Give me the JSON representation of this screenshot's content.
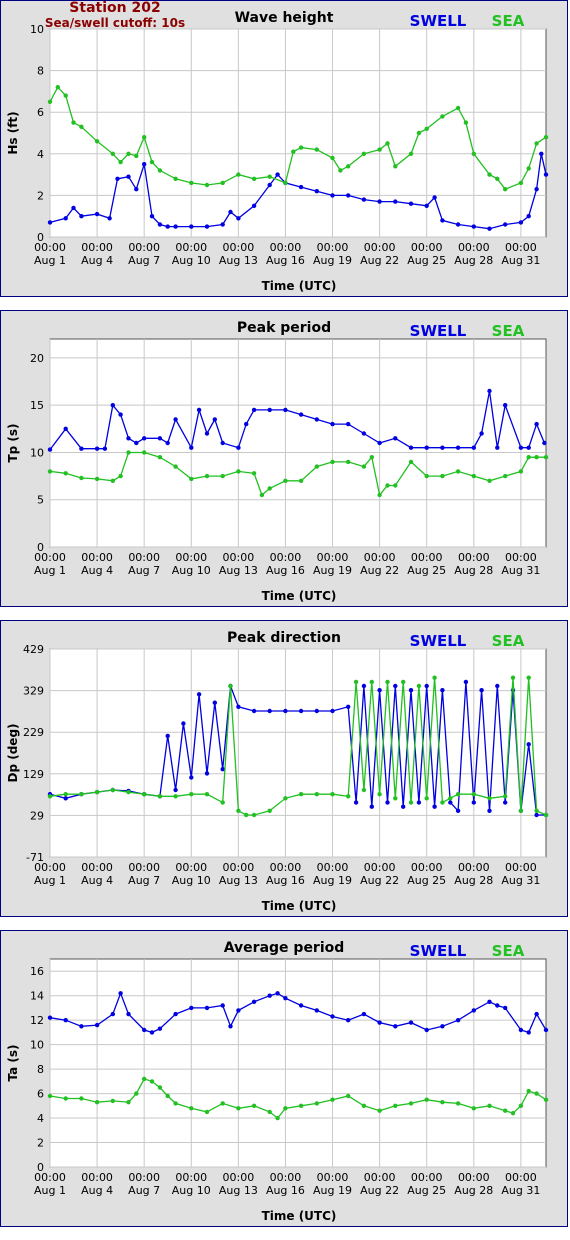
{
  "header": {
    "station": "Station 202",
    "cutoff": "Sea/swell cutoff: 10s"
  },
  "colors": {
    "swell": "#0000e0",
    "sea": "#22c022",
    "station": "#8b0000"
  },
  "x_axis": {
    "ticks": [
      {
        "time": "00:00",
        "date": "Aug 1"
      },
      {
        "time": "00:00",
        "date": "Aug 4"
      },
      {
        "time": "00:00",
        "date": "Aug 7"
      },
      {
        "time": "00:00",
        "date": "Aug 10"
      },
      {
        "time": "00:00",
        "date": "Aug 13"
      },
      {
        "time": "00:00",
        "date": "Aug 16"
      },
      {
        "time": "00:00",
        "date": "Aug 19"
      },
      {
        "time": "00:00",
        "date": "Aug 22"
      },
      {
        "time": "00:00",
        "date": "Aug 25"
      },
      {
        "time": "00:00",
        "date": "Aug 28"
      },
      {
        "time": "00:00",
        "date": "Aug 31"
      }
    ],
    "label": "Time (UTC)"
  },
  "chart_data": [
    {
      "type": "line",
      "title": "Wave height",
      "ylabel": "Hs (ft)",
      "xlabel": "Time (UTC)",
      "ylim": [
        0,
        10
      ],
      "yticks": [
        0,
        2,
        4,
        6,
        8,
        10
      ],
      "xlim": [
        0,
        31.6
      ],
      "legend_position": "top-right",
      "grid": true,
      "series": [
        {
          "name": "SWELL",
          "color": "#0000e0",
          "x": [
            0,
            1,
            1.5,
            2,
            3,
            3.8,
            4.3,
            5,
            5.5,
            6,
            6.5,
            7,
            7.5,
            8,
            9,
            10,
            11,
            11.5,
            12,
            13,
            14,
            14.5,
            15,
            16,
            17,
            18,
            19,
            20,
            21,
            22,
            23,
            24,
            24.5,
            25,
            26,
            27,
            28,
            29,
            30,
            30.5,
            31,
            31.3,
            31.6
          ],
          "y": [
            0.7,
            0.9,
            1.4,
            1.0,
            1.1,
            0.9,
            2.8,
            2.9,
            2.3,
            3.5,
            1.0,
            0.6,
            0.5,
            0.5,
            0.5,
            0.5,
            0.6,
            1.2,
            0.9,
            1.5,
            2.5,
            3.0,
            2.6,
            2.4,
            2.2,
            2.0,
            2.0,
            1.8,
            1.7,
            1.7,
            1.6,
            1.5,
            1.9,
            0.8,
            0.6,
            0.5,
            0.4,
            0.6,
            0.7,
            1.0,
            2.3,
            4.0,
            3.0
          ]
        },
        {
          "name": "SEA",
          "color": "#22c022",
          "x": [
            0,
            0.5,
            1,
            1.5,
            2,
            3,
            4,
            4.5,
            5,
            5.5,
            6,
            6.5,
            7,
            8,
            9,
            10,
            11,
            12,
            13,
            14,
            15,
            15.5,
            16,
            17,
            18,
            18.5,
            19,
            20,
            21,
            21.5,
            22,
            23,
            23.5,
            24,
            25,
            26,
            26.5,
            27,
            28,
            28.5,
            29,
            30,
            30.5,
            31,
            31.6
          ],
          "y": [
            6.5,
            7.2,
            6.8,
            5.5,
            5.3,
            4.6,
            4.0,
            3.6,
            4.0,
            3.9,
            4.8,
            3.6,
            3.2,
            2.8,
            2.6,
            2.5,
            2.6,
            3.0,
            2.8,
            2.9,
            2.6,
            4.1,
            4.3,
            4.2,
            3.8,
            3.2,
            3.4,
            4.0,
            4.2,
            4.5,
            3.4,
            4.0,
            5.0,
            5.2,
            5.8,
            6.2,
            5.5,
            4.0,
            3.0,
            2.8,
            2.3,
            2.6,
            3.3,
            4.5,
            4.8
          ]
        }
      ]
    },
    {
      "type": "line",
      "title": "Peak period",
      "ylabel": "Tp (s)",
      "xlabel": "Time (UTC)",
      "ylim": [
        0,
        22
      ],
      "yticks": [
        0,
        5,
        10,
        15,
        20
      ],
      "xlim": [
        0,
        31.6
      ],
      "legend_position": "top-right",
      "grid": true,
      "series": [
        {
          "name": "SWELL",
          "color": "#0000e0",
          "x": [
            0,
            1,
            2,
            3,
            3.5,
            4,
            4.5,
            5,
            5.5,
            6,
            7,
            7.5,
            8,
            9,
            9.5,
            10,
            10.5,
            11,
            12,
            12.5,
            13,
            14,
            15,
            16,
            17,
            18,
            19,
            20,
            21,
            22,
            23,
            24,
            25,
            26,
            27,
            27.5,
            28,
            28.5,
            29,
            30,
            30.5,
            31,
            31.5
          ],
          "y": [
            10.3,
            12.5,
            10.4,
            10.4,
            10.4,
            15.0,
            14.0,
            11.5,
            11.0,
            11.5,
            11.5,
            11.0,
            13.5,
            10.5,
            14.5,
            12.0,
            13.5,
            11.0,
            10.5,
            13.0,
            14.5,
            14.5,
            14.5,
            14.0,
            13.5,
            13.0,
            13.0,
            12.0,
            11.0,
            11.5,
            10.5,
            10.5,
            10.5,
            10.5,
            10.5,
            12.0,
            16.5,
            10.5,
            15.0,
            10.5,
            10.5,
            13.0,
            11.0
          ]
        },
        {
          "name": "SEA",
          "color": "#22c022",
          "x": [
            0,
            1,
            2,
            3,
            4,
            4.5,
            5,
            6,
            7,
            8,
            9,
            10,
            11,
            12,
            13,
            13.5,
            14,
            15,
            16,
            17,
            18,
            19,
            20,
            20.5,
            21,
            21.5,
            22,
            23,
            24,
            25,
            26,
            27,
            28,
            29,
            30,
            30.5,
            31,
            31.6
          ],
          "y": [
            8.0,
            7.8,
            7.3,
            7.2,
            7.0,
            7.5,
            10.0,
            10.0,
            9.5,
            8.5,
            7.2,
            7.5,
            7.5,
            8.0,
            7.8,
            5.5,
            6.2,
            7.0,
            7.0,
            8.5,
            9.0,
            9.0,
            8.5,
            9.5,
            5.5,
            6.5,
            6.5,
            9.0,
            7.5,
            7.5,
            8.0,
            7.5,
            7.0,
            7.5,
            8.0,
            9.5,
            9.5,
            9.5
          ]
        }
      ]
    },
    {
      "type": "line",
      "title": "Peak direction",
      "ylabel": "Dp (deg)",
      "xlabel": "Time (UTC)",
      "ylim": [
        -71,
        429
      ],
      "yticks": [
        -71,
        29,
        129,
        229,
        329,
        429
      ],
      "xlim": [
        0,
        31.6
      ],
      "legend_position": "top-right",
      "grid": true,
      "series": [
        {
          "name": "SWELL",
          "color": "#0000e0",
          "x": [
            0,
            1,
            2,
            3,
            4,
            5,
            6,
            7,
            7.5,
            8,
            8.5,
            9,
            9.5,
            10,
            10.5,
            11,
            11.5,
            12,
            13,
            14,
            15,
            16,
            17,
            18,
            19,
            19.5,
            20,
            20.5,
            21,
            21.5,
            22,
            22.5,
            23,
            23.5,
            24,
            24.5,
            25,
            25.5,
            26,
            26.5,
            27,
            27.5,
            28,
            28.5,
            29,
            29.5,
            30,
            30.5,
            31,
            31.6
          ],
          "y": [
            80,
            70,
            80,
            85,
            90,
            88,
            80,
            75,
            220,
            90,
            250,
            120,
            320,
            130,
            300,
            140,
            340,
            290,
            280,
            280,
            280,
            280,
            280,
            280,
            290,
            60,
            340,
            50,
            330,
            60,
            340,
            50,
            330,
            60,
            340,
            50,
            330,
            60,
            40,
            350,
            60,
            330,
            40,
            340,
            60,
            330,
            40,
            200,
            30,
            30
          ]
        },
        {
          "name": "SEA",
          "color": "#22c022",
          "x": [
            0,
            1,
            2,
            3,
            4,
            5,
            6,
            7,
            8,
            9,
            10,
            11,
            11.5,
            12,
            12.5,
            13,
            14,
            15,
            16,
            17,
            18,
            19,
            19.5,
            20,
            20.5,
            21,
            21.5,
            22,
            22.5,
            23,
            23.5,
            24,
            24.5,
            25,
            25.5,
            26,
            27,
            28,
            29,
            29.5,
            30,
            30.5,
            31,
            31.6
          ],
          "y": [
            75,
            80,
            80,
            85,
            90,
            85,
            80,
            75,
            75,
            80,
            80,
            60,
            340,
            40,
            30,
            30,
            40,
            70,
            80,
            80,
            80,
            75,
            350,
            90,
            350,
            80,
            350,
            70,
            350,
            60,
            340,
            70,
            360,
            60,
            70,
            80,
            80,
            70,
            75,
            360,
            40,
            360,
            40,
            30
          ]
        }
      ]
    },
    {
      "type": "line",
      "title": "Average period",
      "ylabel": "Ta (s)",
      "xlabel": "Time (UTC)",
      "ylim": [
        0,
        17
      ],
      "yticks": [
        0,
        2,
        4,
        6,
        8,
        10,
        12,
        14,
        16
      ],
      "xlim": [
        0,
        31.6
      ],
      "legend_position": "top-right",
      "grid": true,
      "series": [
        {
          "name": "SWELL",
          "color": "#0000e0",
          "x": [
            0,
            1,
            2,
            3,
            4,
            4.5,
            5,
            6,
            6.5,
            7,
            8,
            9,
            10,
            11,
            11.5,
            12,
            13,
            14,
            14.5,
            15,
            16,
            17,
            18,
            19,
            20,
            21,
            22,
            23,
            24,
            25,
            26,
            27,
            28,
            28.5,
            29,
            30,
            30.5,
            31,
            31.6
          ],
          "y": [
            12.2,
            12.0,
            11.5,
            11.6,
            12.5,
            14.2,
            12.5,
            11.2,
            11.0,
            11.3,
            12.5,
            13.0,
            13.0,
            13.2,
            11.5,
            12.8,
            13.5,
            14.0,
            14.2,
            13.8,
            13.2,
            12.8,
            12.3,
            12.0,
            12.5,
            11.8,
            11.5,
            11.8,
            11.2,
            11.5,
            12.0,
            12.8,
            13.5,
            13.2,
            13.0,
            11.2,
            11.0,
            12.5,
            11.2
          ]
        },
        {
          "name": "SEA",
          "color": "#22c022",
          "x": [
            0,
            1,
            2,
            3,
            4,
            5,
            5.5,
            6,
            6.5,
            7,
            7.5,
            8,
            9,
            10,
            11,
            12,
            13,
            14,
            14.5,
            15,
            16,
            17,
            18,
            19,
            20,
            21,
            22,
            23,
            24,
            25,
            26,
            27,
            28,
            29,
            29.5,
            30,
            30.5,
            31,
            31.6
          ],
          "y": [
            5.8,
            5.6,
            5.6,
            5.3,
            5.4,
            5.3,
            6.0,
            7.2,
            7.0,
            6.5,
            5.8,
            5.2,
            4.8,
            4.5,
            5.2,
            4.8,
            5.0,
            4.5,
            4.0,
            4.8,
            5.0,
            5.2,
            5.5,
            5.8,
            5.0,
            4.6,
            5.0,
            5.2,
            5.5,
            5.3,
            5.2,
            4.8,
            5.0,
            4.6,
            4.4,
            5.0,
            6.2,
            6.0,
            5.5
          ]
        }
      ]
    }
  ]
}
